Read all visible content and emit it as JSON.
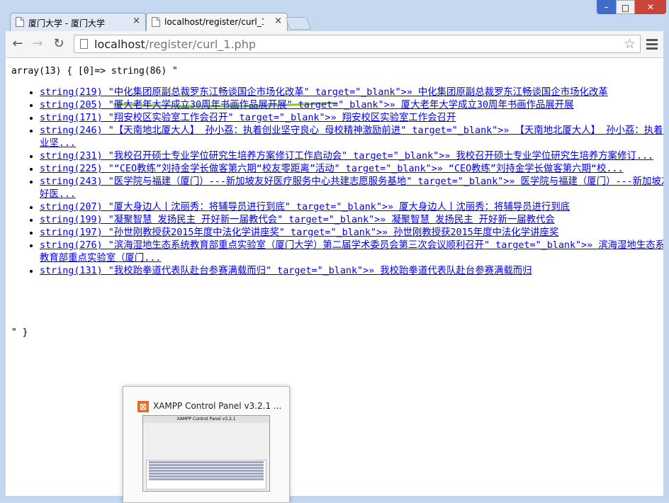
{
  "tabs": [
    {
      "label": "厦门大学 - 厦门大学",
      "close": "×"
    },
    {
      "label": "localhost/register/curl_1",
      "close": "×"
    }
  ],
  "window_controls": {
    "minimize": "–",
    "maximize": "□",
    "close": "✕"
  },
  "toolbar": {
    "back": "←",
    "forward": "→",
    "reload": "↻",
    "url_host": "localhost",
    "url_path": "/register/curl_1.php",
    "star": "☆"
  },
  "page": {
    "dump_header": "array(13) { [0]=> string(86) \"",
    "items": [
      "string(219) \"中化集团原副总裁罗东江畅谈国企市场化改革\" target=\"_blank\">» 中化集团原副总裁罗东江畅谈国企市场化改革",
      "string(205) \"厦大老年大学成立30周年书画作品展开展\" target=\"_blank\">» 厦大老年大学成立30周年书画作品展开展",
      "string(171) \"翔安校区实验室工作会召开\" target=\"_blank\">» 翔安校区实验室工作会召开",
      "string(246) \"【天南地北厦大人】 孙小荔：执着创业坚守良心 母校精神激励前进\" target=\"_blank\">» 【天南地北厦大人】 孙小荔：执着创业坚...",
      "string(231) \"我校召开硕士专业学位研究生培养方案修订工作启动会\" target=\"_blank\">» 我校召开硕士专业学位研究生培养方案修订...",
      "string(225) \"“CEO教练”刘持金学长做客第六期“校友零距离”活动\" target=\"_blank\">» “CEO教练”刘持金学长做客第六期“校...",
      "string(243) \"医学院与福建（厦门）---新加坡友好医疗服务中心共建志愿服务基地\" target=\"_blank\">» 医学院与福建（厦门）---新加坡友好医...",
      "string(207) \"厦大身边人丨沈丽秀：将辅导员进行到底\" target=\"_blank\">» 厦大身边人丨沈丽秀：将辅导员进行到底",
      "string(199) \"凝聚智慧 发扬民主 开好新一届教代会\" target=\"_blank\">» 凝聚智慧 发扬民主 开好新一届教代会",
      "string(197) \"孙世刚教授获2015年度中法化学讲座奖\" target=\"_blank\">» 孙世刚教授获2015年度中法化学讲座奖",
      "string(276) \"滨海湿地生态系统教育部重点实验室（厦门大学）第二届学术委员会第三次会议顺利召开\" target=\"_blank\">» 滨海湿地生态系统教育部重点实验室（厦门...",
      "string(131) \"我校跆拳道代表队赴台参赛满载而归\" target=\"_blank\">» 我校跆拳道代表队赴台参赛满载而归"
    ],
    "dump_footer": "\" }"
  },
  "taskbar_preview": {
    "title": "XAMPP Control Panel v3.2.1 ...",
    "icon": "xampp-icon",
    "thumb_title": "XAMPP Control Panel v3.2.1"
  },
  "colors": {
    "link": "#0000ee",
    "highlight": "#8cc63f",
    "close_button": "#c9453a"
  }
}
